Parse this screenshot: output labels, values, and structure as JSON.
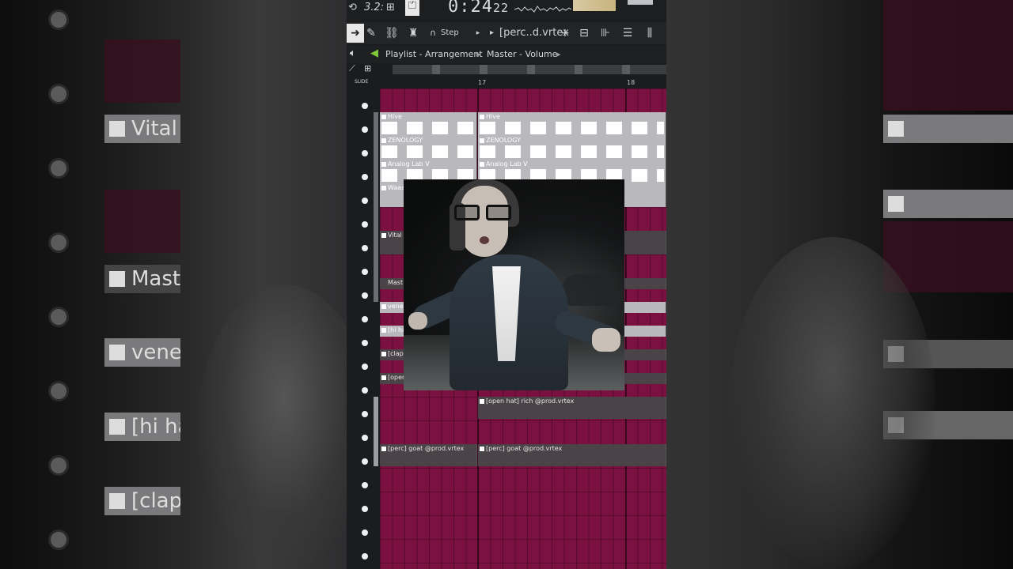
{
  "topbar": {
    "counter": "3.2:",
    "time_main": "0:24",
    "time_sub": "22"
  },
  "toolbar": {
    "step_label": "Step",
    "pattern_name": "[perc..d.vrtex",
    "add_symbol": "+"
  },
  "titlebar": {
    "window_title": "Playlist - Arrangement",
    "breadcrumb": "Master - Volume",
    "chevron": "▸"
  },
  "ruler": {
    "slide_label": "SLIDE",
    "bar_17": "17",
    "bar_18": "18"
  },
  "tracks": [
    {
      "clips": [
        {
          "name": "Hive"
        },
        {
          "name": "Hive"
        }
      ]
    },
    {
      "clips": [
        {
          "name": "ZENOLOGY"
        },
        {
          "name": "ZENOLOGY"
        }
      ]
    },
    {
      "clips": [
        {
          "name": "Analog Lab V"
        },
        {
          "name": "Analog Lab V"
        }
      ]
    },
    {
      "clips": [
        {
          "name": "Waaa"
        }
      ]
    },
    {
      "clips": [
        {
          "name": "Vital"
        }
      ]
    },
    {
      "clips": [
        {
          "name": "Mast"
        }
      ]
    },
    {
      "clips": [
        {
          "name": "vene"
        }
      ]
    },
    {
      "clips": [
        {
          "name": "[hi ha"
        }
      ]
    },
    {
      "clips": [
        {
          "name": "[clap"
        }
      ]
    },
    {
      "clips": [
        {
          "name": "[open"
        }
      ]
    },
    {
      "clips": [
        {
          "name": "[open hat] rich @prod.vrtex"
        }
      ]
    },
    {
      "clips": [
        {
          "name": "[perc] goat @prod.vrtex"
        },
        {
          "name": "[perc] goat @prod.vrtex"
        }
      ]
    }
  ],
  "background_labels": {
    "vital": "Vital",
    "master": "Maste",
    "vene": "vene",
    "hihat": "[hi ha",
    "clap": "[clap"
  },
  "colors": {
    "playlist_bg": "#7a1140",
    "clip_light": "#b9b8bd",
    "clip_dark": "#4a4347",
    "accent_green": "#7ec83a"
  }
}
